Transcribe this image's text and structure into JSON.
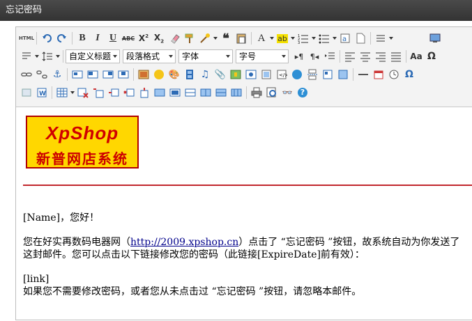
{
  "window": {
    "title": "忘记密码"
  },
  "toolbar": {
    "row1_buttons": [
      "html-source",
      "undo",
      "redo",
      "bold",
      "italic",
      "underline",
      "strikethrough",
      "superscript",
      "subscript",
      "eraser",
      "format-painter",
      "auto-format",
      "blockquote",
      "paste-plain",
      "font-color",
      "background-color",
      "ordered-list",
      "unordered-list",
      "select-all",
      "clear-doc",
      "row-spacing",
      "fullscreen"
    ],
    "dropdowns": {
      "custom_title": "自定义标题",
      "paragraph_format": "段落格式",
      "font_family": "字体",
      "font_size": "字号"
    }
  },
  "email": {
    "logo_text": "XpShop",
    "logo_subtext": "新普网店系统",
    "greeting": "[Name]，您好！",
    "line1_before_link": "您在好实再数码电器网（",
    "link_text": "http://2009.xpshop.cn",
    "line1_after_link": "）点击了 “忘记密码 ”按钮，故系统自动为你发送了这封邮件。您可以点击以下链接修改您的密码（此链接[ExpireDate]前有效）：",
    "link_placeholder": "[link]",
    "closing": "如果您不需要修改密码，或者您从未点击过 “忘记密码 ”按钮，请忽略本邮件。"
  },
  "colors": {
    "accent_red": "#c1272d",
    "logo_bg": "#ffd700",
    "link": "#00008b"
  }
}
